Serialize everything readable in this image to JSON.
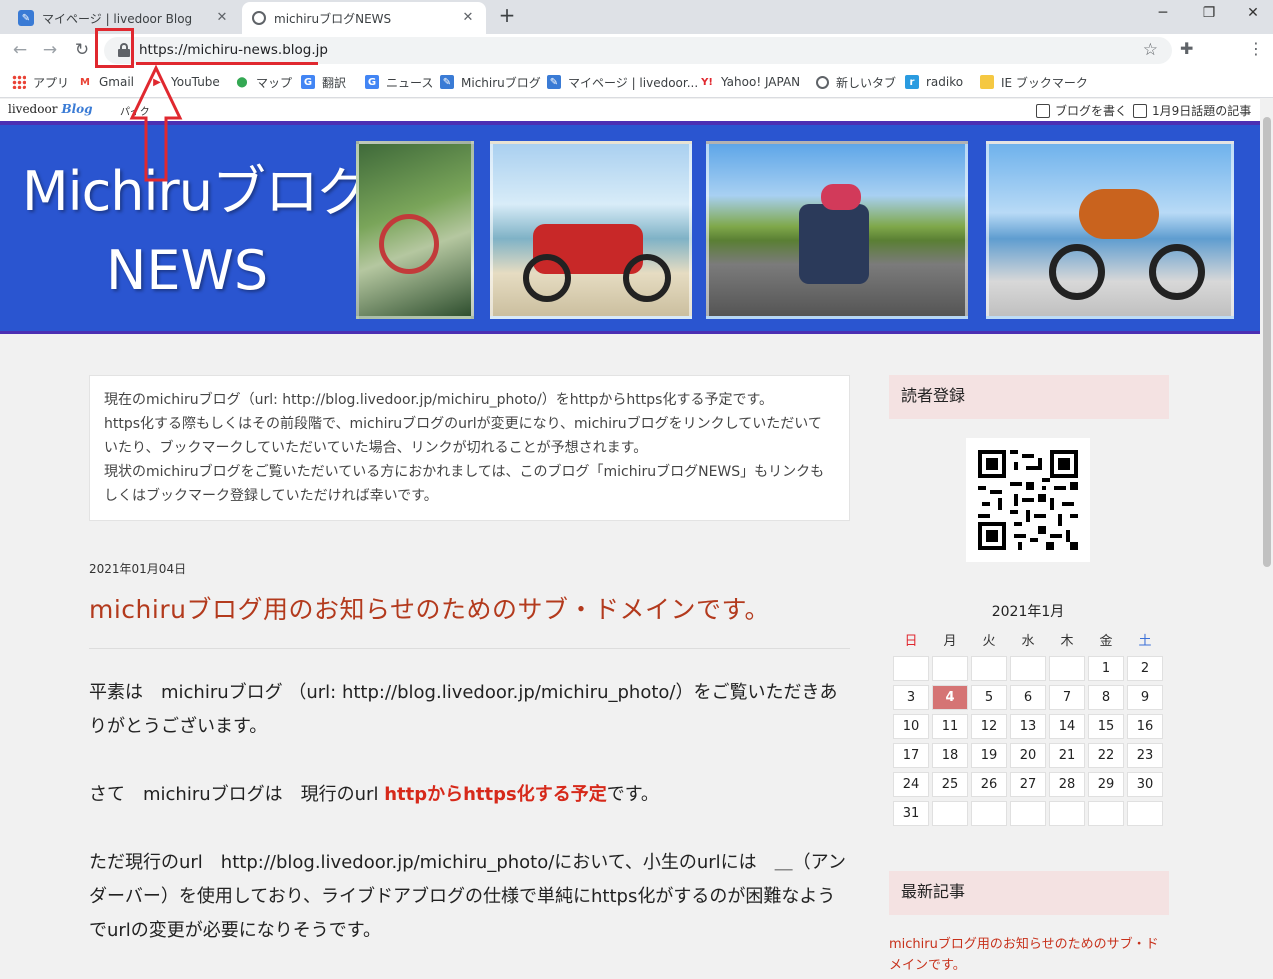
{
  "browser": {
    "tabs": [
      {
        "title": "マイページ | livedoor Blog",
        "active": false
      },
      {
        "title": "michiruブログNEWS",
        "active": true
      }
    ],
    "url": "https://michiru-news.blog.jp",
    "bookmarks": [
      "アプリ",
      "Gmail",
      "YouTube",
      "マップ",
      "翻訳",
      "ニュース",
      "Michiruブログ",
      "マイページ | livedoor...",
      "Yahoo! JAPAN",
      "新しいタブ",
      "radiko",
      "IE ブックマーク"
    ]
  },
  "livedoor_bar": {
    "logo": "livedoor",
    "logo_blog": "Blog",
    "pa": "パイク",
    "write": "ブログを書く",
    "topic": "1月9日話題の記事"
  },
  "banner": {
    "title_line1": "Michiruブログ",
    "title_line2": "NEWS"
  },
  "notice": {
    "lines": [
      "現在のmichiruブログ（url: http://blog.livedoor.jp/michiru_photo/）をhttpからhttps化する予定です。",
      "https化する際もしくはその前段階で、michiruブログのurlが変更になり、michiruブログをリンクしていただいていたり、ブックマークしていただいていた場合、リンクが切れることが予想されます。",
      "現状のmichiruブログをご覧いただいている方におかれましては、このブログ「michiruブログNEWS」もリンクもしくはブックマーク登録していただければ幸いです。"
    ]
  },
  "post": {
    "date": "2021年01月04日",
    "title": "michiruブログ用のお知らせのためのサブ・ドメインです。",
    "p1": "平素は　michiruブログ （url: http://blog.livedoor.jp/michiru_photo/）をご覧いただきありがとうございます。",
    "p2_pre": "さて　michiruブログは　現行のurl ",
    "p2_highlight": "httpからhttps化する予定",
    "p2_post": "です。",
    "p3": "ただ現行のurl　http://blog.livedoor.jp/michiru_photo/において、小生のurlには　＿（アンダーバー）を使用しており、ライブドアブログの仕様で単純にhttps化がするのが困難なようでurlの変更が必要になりそうです。"
  },
  "sidebar": {
    "reader_heading": "読者登録",
    "calendar_title": "2021年1月",
    "weekdays": [
      "日",
      "月",
      "火",
      "水",
      "木",
      "金",
      "土"
    ],
    "weeks": [
      [
        "",
        "",
        "",
        "",
        "",
        "1",
        "2"
      ],
      [
        "3",
        "4",
        "5",
        "6",
        "7",
        "8",
        "9"
      ],
      [
        "10",
        "11",
        "12",
        "13",
        "14",
        "15",
        "16"
      ],
      [
        "17",
        "18",
        "19",
        "20",
        "21",
        "22",
        "23"
      ],
      [
        "24",
        "25",
        "26",
        "27",
        "28",
        "29",
        "30"
      ],
      [
        "31",
        "",
        "",
        "",
        "",
        "",
        ""
      ]
    ],
    "today": "4",
    "latest_heading": "最新記事",
    "latest_item": "michiruブログ用のお知らせのためのサブ・ドメインです。"
  },
  "colors": {
    "sunday": "#e0282f",
    "saturday": "#3a6fd8",
    "annotation": "#e0282f",
    "banner_bg": "#2a55d0"
  }
}
